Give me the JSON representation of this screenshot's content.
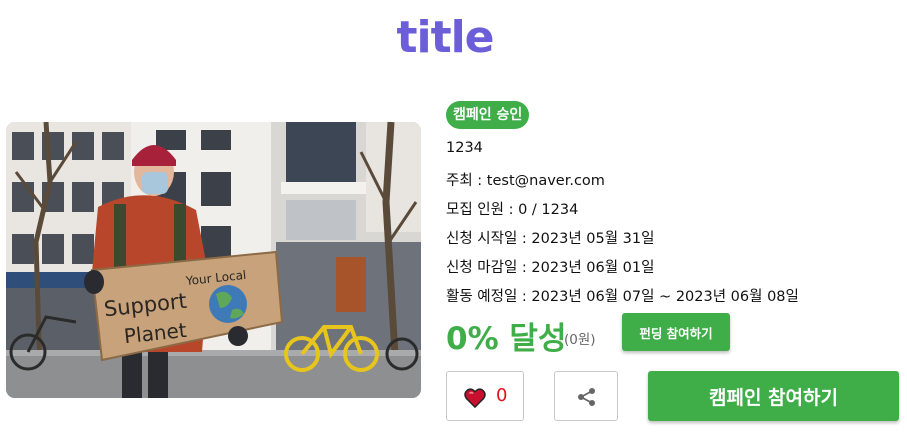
{
  "page": {
    "title": "title"
  },
  "campaign": {
    "badge": "캠페인 승인",
    "name": "1234",
    "host": "주최 : test@naver.com",
    "recruit": "모집 인원 : 0 / 1234",
    "apply_start": "신청 시작일 : 2023년 05월 31일",
    "apply_end": "신청 마감일 : 2023년 06월 01일",
    "activity_period": "활동 예정일 : 2023년 06월 07일 ~ 2023년 06월 08일",
    "achievement": "0% 달성",
    "amount": "(0원)",
    "progress_percent": 0
  },
  "image": {
    "sign_text_1": "Support",
    "sign_text_2": "Your Local",
    "sign_text_3": "Planet"
  },
  "buttons": {
    "fund": "펀딩 참여하기",
    "like_count": "0",
    "join": "캠페인 참여하기"
  },
  "icons": {
    "like": "heart-icon",
    "share": "share-icon"
  },
  "colors": {
    "title": "#6b5ed8",
    "accent": "#3fae49",
    "like_count": "#e0141e"
  }
}
